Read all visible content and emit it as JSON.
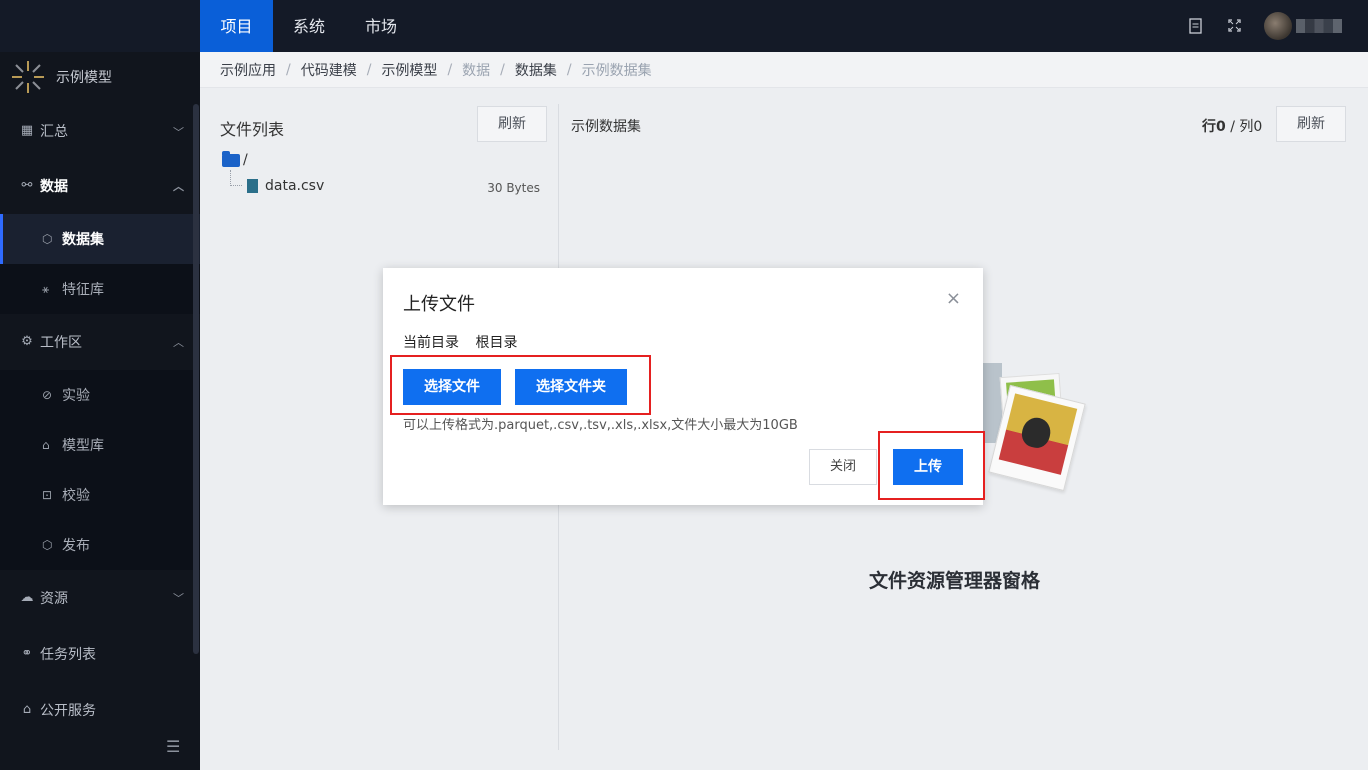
{
  "topnav": {
    "tabs": [
      "项目",
      "系统",
      "市场"
    ],
    "active": 0
  },
  "sidebar": {
    "brand": "示例模型",
    "items": [
      {
        "label": "汇总",
        "icon": "dashboard-icon",
        "type": "group",
        "expanded": false
      },
      {
        "label": "数据",
        "icon": "hierarchy-icon",
        "type": "group",
        "expanded": true
      },
      {
        "label": "数据集",
        "icon": "cube-icon",
        "type": "sub",
        "selected": true
      },
      {
        "label": "特征库",
        "icon": "feature-icon",
        "type": "sub"
      },
      {
        "label": "工作区",
        "icon": "gear-icon",
        "type": "group",
        "expanded": true
      },
      {
        "label": "实验",
        "icon": "experiment-icon",
        "type": "sub"
      },
      {
        "label": "模型库",
        "icon": "model-icon",
        "type": "sub"
      },
      {
        "label": "校验",
        "icon": "scan-icon",
        "type": "sub"
      },
      {
        "label": "发布",
        "icon": "publish-icon",
        "type": "sub"
      },
      {
        "label": "资源",
        "icon": "cloud-icon",
        "type": "group",
        "expanded": false
      },
      {
        "label": "任务列表",
        "icon": "task-icon",
        "type": "group"
      },
      {
        "label": "公开服务",
        "icon": "store-icon",
        "type": "group"
      }
    ]
  },
  "breadcrumb": [
    "示例应用",
    "代码建模",
    "示例模型",
    "数据",
    "数据集",
    "示例数据集"
  ],
  "left_panel": {
    "title": "文件列表",
    "refresh": "刷新",
    "root": "/",
    "file_name": "data.csv",
    "file_size": "30 Bytes"
  },
  "right_panel": {
    "title": "示例数据集",
    "rows_label": "行0",
    "sep": "/",
    "cols_label": "列0",
    "refresh": "刷新",
    "empty_title": "文件资源管理器窗格"
  },
  "modal": {
    "title": "上传文件",
    "close_icon": "×",
    "current_dir_label": "当前目录",
    "current_dir_value": "根目录",
    "select_file": "选择文件",
    "select_folder": "选择文件夹",
    "hint": "可以上传格式为.parquet,.csv,.tsv,.xls,.xlsx,文件大小最大为10GB",
    "cancel": "关闭",
    "upload": "上传"
  },
  "colors": {
    "primary": "#0f6ff0",
    "sidebar": "#11151d",
    "highlight": "#e52020"
  }
}
